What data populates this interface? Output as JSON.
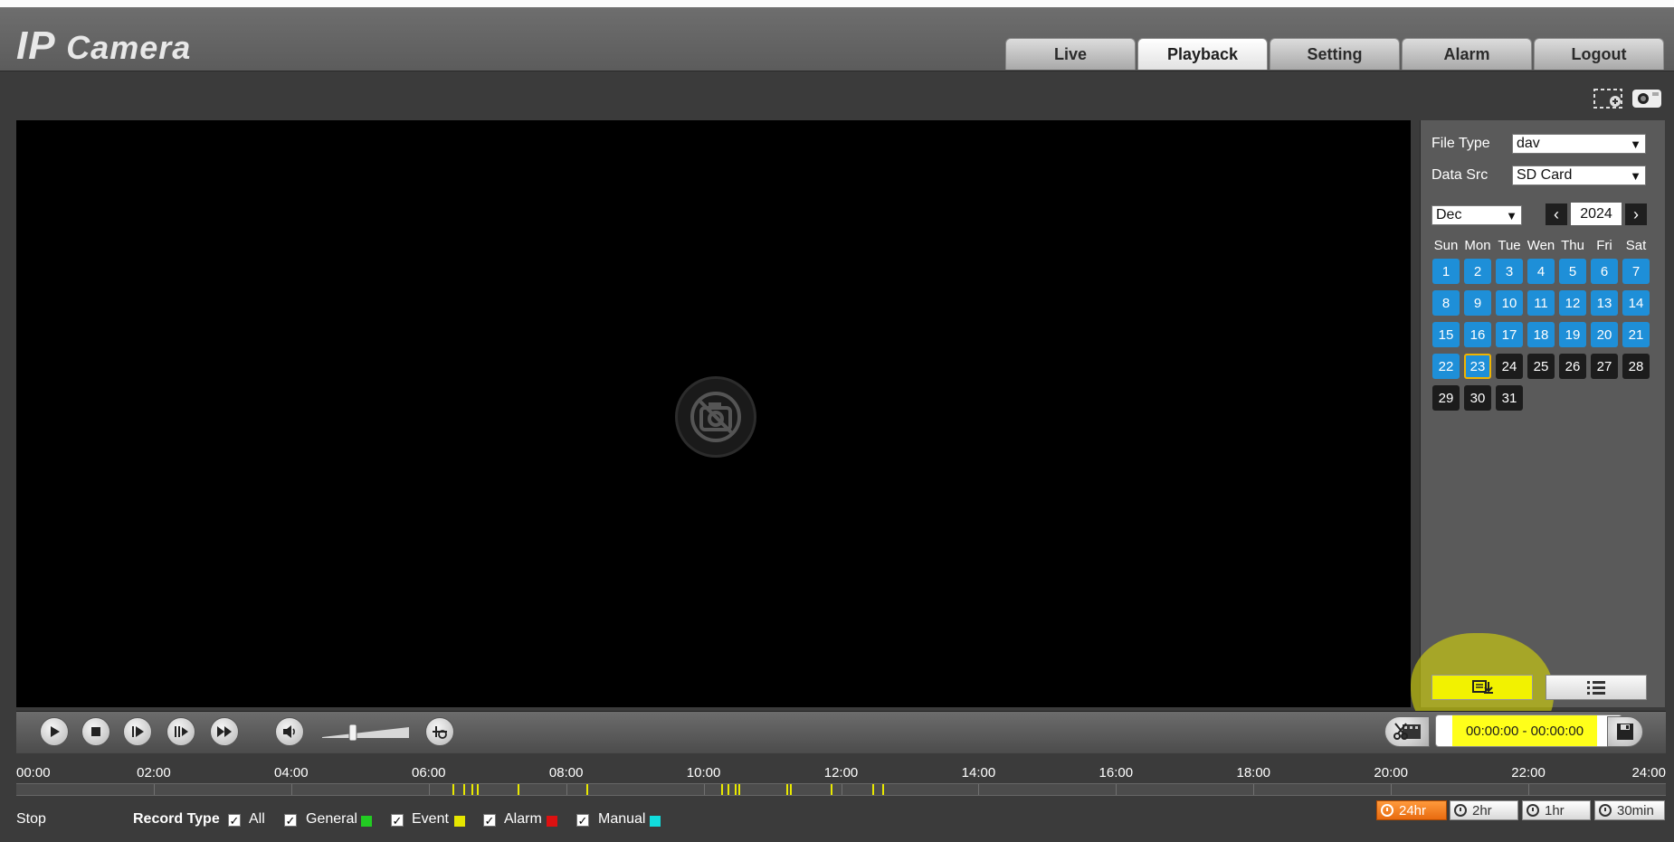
{
  "header": {
    "logo_ip": "IP",
    "logo_camera": "Camera",
    "tabs": [
      {
        "label": "Live"
      },
      {
        "label": "Playback"
      },
      {
        "label": "Setting"
      },
      {
        "label": "Alarm"
      },
      {
        "label": "Logout"
      }
    ],
    "active_tab": "Playback"
  },
  "panel": {
    "file_type_label": "File Type",
    "file_type_value": "dav",
    "data_src_label": "Data Src",
    "data_src_value": "SD Card",
    "month_value": "Dec",
    "year_value": "2024",
    "weekdays": [
      "Sun",
      "Mon",
      "Tue",
      "Wen",
      "Thu",
      "Fri",
      "Sat"
    ],
    "days": [
      "1",
      "2",
      "3",
      "4",
      "5",
      "6",
      "7",
      "8",
      "9",
      "10",
      "11",
      "12",
      "13",
      "14",
      "15",
      "16",
      "17",
      "18",
      "19",
      "20",
      "21",
      "22",
      "23",
      "24",
      "25",
      "26",
      "27",
      "28",
      "29",
      "30",
      "31"
    ],
    "days_with_records_through": 23,
    "selected_day": 23
  },
  "controls": {
    "time_range": "00:00:00 - 00:00:00",
    "volume_level": 0.35
  },
  "timeline": {
    "labels": [
      "00:00",
      "02:00",
      "04:00",
      "06:00",
      "08:00",
      "10:00",
      "12:00",
      "14:00",
      "16:00",
      "18:00",
      "20:00",
      "22:00",
      "24:00"
    ],
    "event_times": [
      6.35,
      6.5,
      6.62,
      6.7,
      7.3,
      8.3,
      10.25,
      10.35,
      10.45,
      10.5,
      11.2,
      11.25,
      11.85,
      12.45,
      12.6
    ]
  },
  "bottom": {
    "status": "Stop",
    "record_type_label": "Record Type",
    "types": [
      {
        "label": "All",
        "color": ""
      },
      {
        "label": "General",
        "color": "#22cc22"
      },
      {
        "label": "Event",
        "color": "#e6e600"
      },
      {
        "label": "Alarm",
        "color": "#dd1111"
      },
      {
        "label": "Manual",
        "color": "#11dddd"
      }
    ],
    "zoom": [
      {
        "label": "24hr",
        "active": true
      },
      {
        "label": "2hr",
        "active": false
      },
      {
        "label": "1hr",
        "active": false
      },
      {
        "label": "30min",
        "active": false
      }
    ]
  }
}
